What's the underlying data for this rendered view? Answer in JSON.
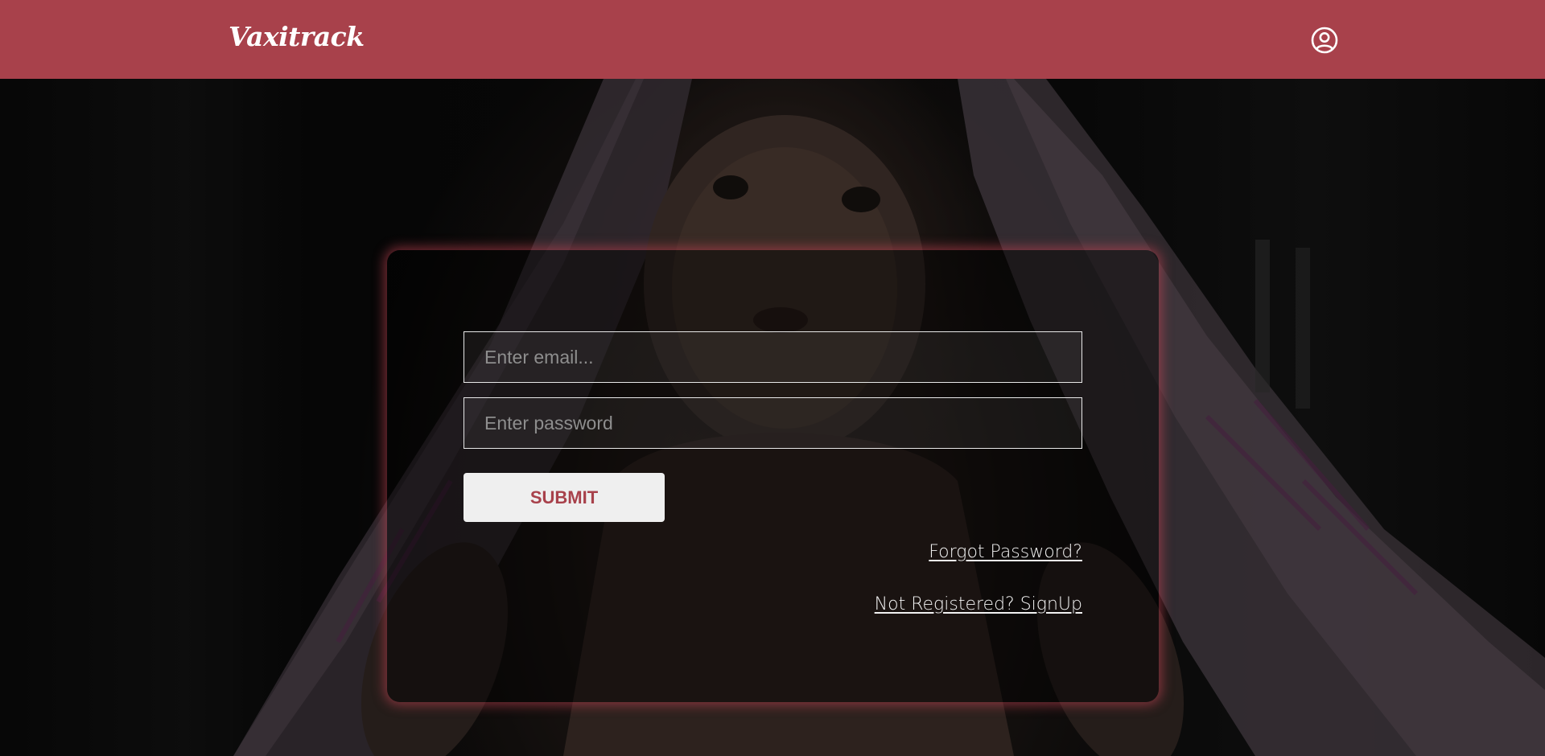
{
  "brand": {
    "name": "Vaxitrack",
    "accent_color": "#a8414b"
  },
  "header": {
    "user_icon": "user-circle-icon"
  },
  "login": {
    "email_placeholder": "Enter email...",
    "email_value": "",
    "password_placeholder": "Enter password",
    "password_value": "",
    "submit_label": "SUBMIT",
    "forgot_label": "Forgot Password?",
    "signup_label": "Not Registered? SignUp"
  }
}
